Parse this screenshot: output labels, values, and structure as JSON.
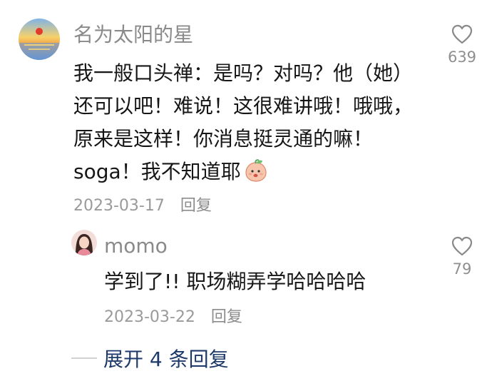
{
  "comment": {
    "username": "名为太阳的星",
    "text_lines": [
      "我一般口头禅：是吗？对吗？他（她）",
      "还可以吧！难说！这很难讲哦！哦哦，",
      "原来是这样！你消息挺灵通的嘛！",
      "soga！我不知道耶"
    ],
    "emoji_icon": "peach-emoji-icon",
    "date": "2023-03-17",
    "reply_label": "回复",
    "likes": "639"
  },
  "reply": {
    "username": "momo",
    "text": "学到了!! 职场糊弄学哈哈哈哈",
    "date": "2023-03-22",
    "reply_label": "回复",
    "likes": "79"
  },
  "expand": {
    "label": "展开 4 条回复"
  },
  "colors": {
    "username": "#8a8a8a",
    "meta": "#9a9a9a",
    "expand_link": "#1e3a6a",
    "heart_outline": "#8a8a8a"
  }
}
